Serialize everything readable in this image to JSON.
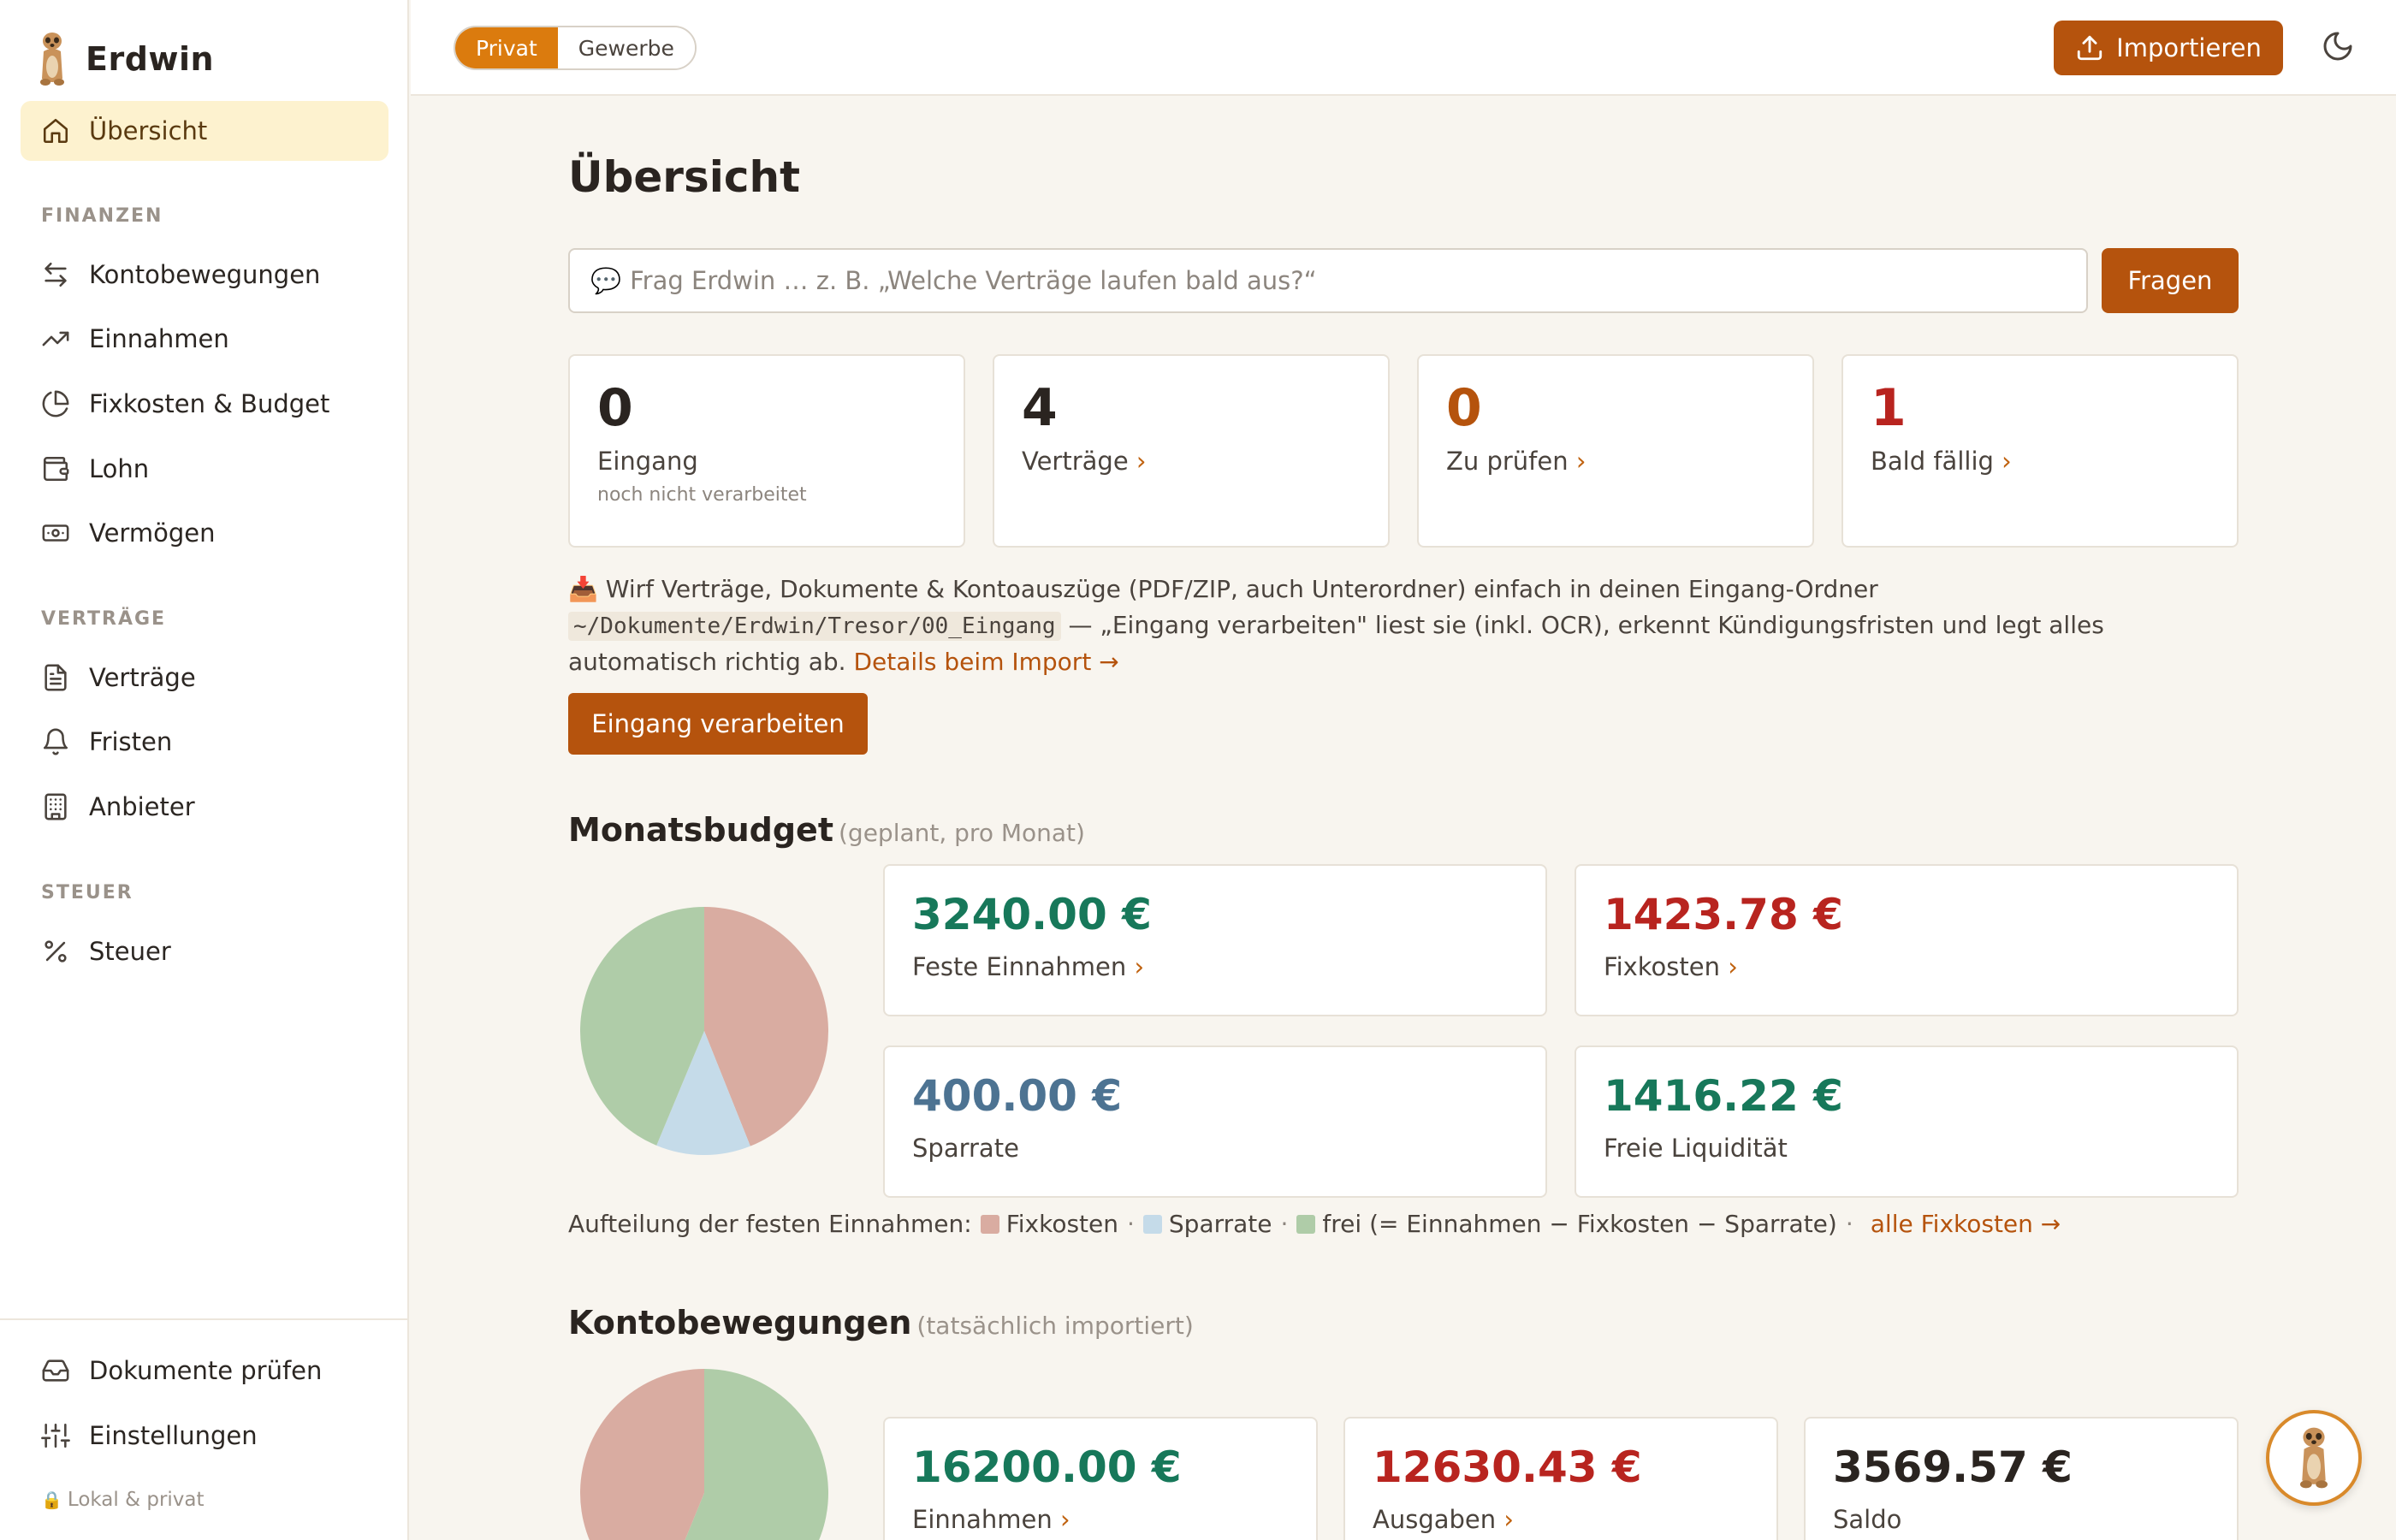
{
  "app": {
    "name": "Erdwin",
    "logo_icon": "meerkat-icon"
  },
  "sidebar": {
    "overview": "Übersicht",
    "sections": [
      {
        "title": "FINANZEN",
        "items": [
          "Kontobewegungen",
          "Einnahmen",
          "Fixkosten & Budget",
          "Lohn",
          "Vermögen"
        ]
      },
      {
        "title": "VERTRÄGE",
        "items": [
          "Verträge",
          "Fristen",
          "Anbieter"
        ]
      },
      {
        "title": "STEUER",
        "items": [
          "Steuer"
        ]
      }
    ],
    "footer_items": [
      "Dokumente prüfen",
      "Einstellungen"
    ],
    "local_note": "Lokal & privat"
  },
  "topbar": {
    "modes": [
      "Privat",
      "Gewerbe"
    ],
    "active_mode": "Privat",
    "import_label": "Importieren"
  },
  "main": {
    "title": "Übersicht",
    "ask": {
      "placeholder": "Frag Erdwin … z. B. „Welche Verträge laufen bald aus?“",
      "button": "Fragen"
    },
    "stats": [
      {
        "value": "0",
        "label": "Eingang",
        "sub": "noch nicht verarbeitet",
        "chev": ""
      },
      {
        "value": "4",
        "label": "Verträge",
        "sub": "",
        "chev": "›"
      },
      {
        "value": "0",
        "label": "Zu prüfen",
        "sub": "",
        "chev": "›"
      },
      {
        "value": "1",
        "label": "Bald fällig",
        "sub": "",
        "chev": "›"
      }
    ],
    "info": {
      "text1": "Wirf Verträge, Dokumente & Kontoauszüge (PDF/ZIP, auch Unterordner) einfach in deinen Eingang-Ordner",
      "path": "~/Dokumente/Erdwin/Tresor/00_Eingang",
      "text2": "— „Eingang verarbeiten\" liest sie (inkl. OCR), erkennt Kündigungsfristen und legt alles automatisch richtig ab.",
      "link": "Details beim Import →"
    },
    "process_button": "Eingang verarbeiten",
    "budget": {
      "title": "Monatsbudget",
      "subtitle": "(geplant, pro Monat)",
      "cards": [
        {
          "amount": "3240.00 €",
          "label": "Feste Einnahmen",
          "chev": "›"
        },
        {
          "amount": "1423.78 €",
          "label": "Fixkosten",
          "chev": "›"
        },
        {
          "amount": "400.00 €",
          "label": "Sparrate",
          "chev": ""
        },
        {
          "amount": "1416.22 €",
          "label": "Freie Liquidität",
          "chev": ""
        }
      ],
      "legend": {
        "prefix": "Aufteilung der festen Einnahmen:",
        "items": [
          "Fixkosten",
          "Sparrate",
          "frei (= Einnahmen − Fixkosten − Sparrate)"
        ],
        "link": "alle Fixkosten →"
      }
    },
    "transactions": {
      "title": "Kontobewegungen",
      "subtitle": "(tatsächlich importiert)",
      "cards": [
        {
          "amount": "16200.00 €",
          "label": "Einnahmen",
          "chev": "›"
        },
        {
          "amount": "12630.43 €",
          "label": "Ausgaben",
          "chev": "›"
        },
        {
          "amount": "3569.57 €",
          "label": "Saldo",
          "chev": ""
        }
      ]
    }
  },
  "chart_data": [
    {
      "type": "pie",
      "title": "",
      "labels": [
        "Fixkosten",
        "Sparrate",
        "frei"
      ],
      "values": [
        1423.78,
        400.0,
        1416.22
      ],
      "colors": [
        "#d9aca1",
        "#c5dbe9",
        "#afcca8"
      ]
    },
    {
      "type": "pie",
      "title": "",
      "labels": [
        "Einnahmen",
        "Ausgaben"
      ],
      "values": [
        16200.0,
        12630.43
      ],
      "colors": [
        "#afcca8",
        "#d9aca1"
      ]
    }
  ],
  "colors": {
    "accent": "#b5530d",
    "mode_active": "#db7b0e",
    "positive": "#17785a",
    "negative": "#b8241f",
    "savings": "#4d7392"
  }
}
